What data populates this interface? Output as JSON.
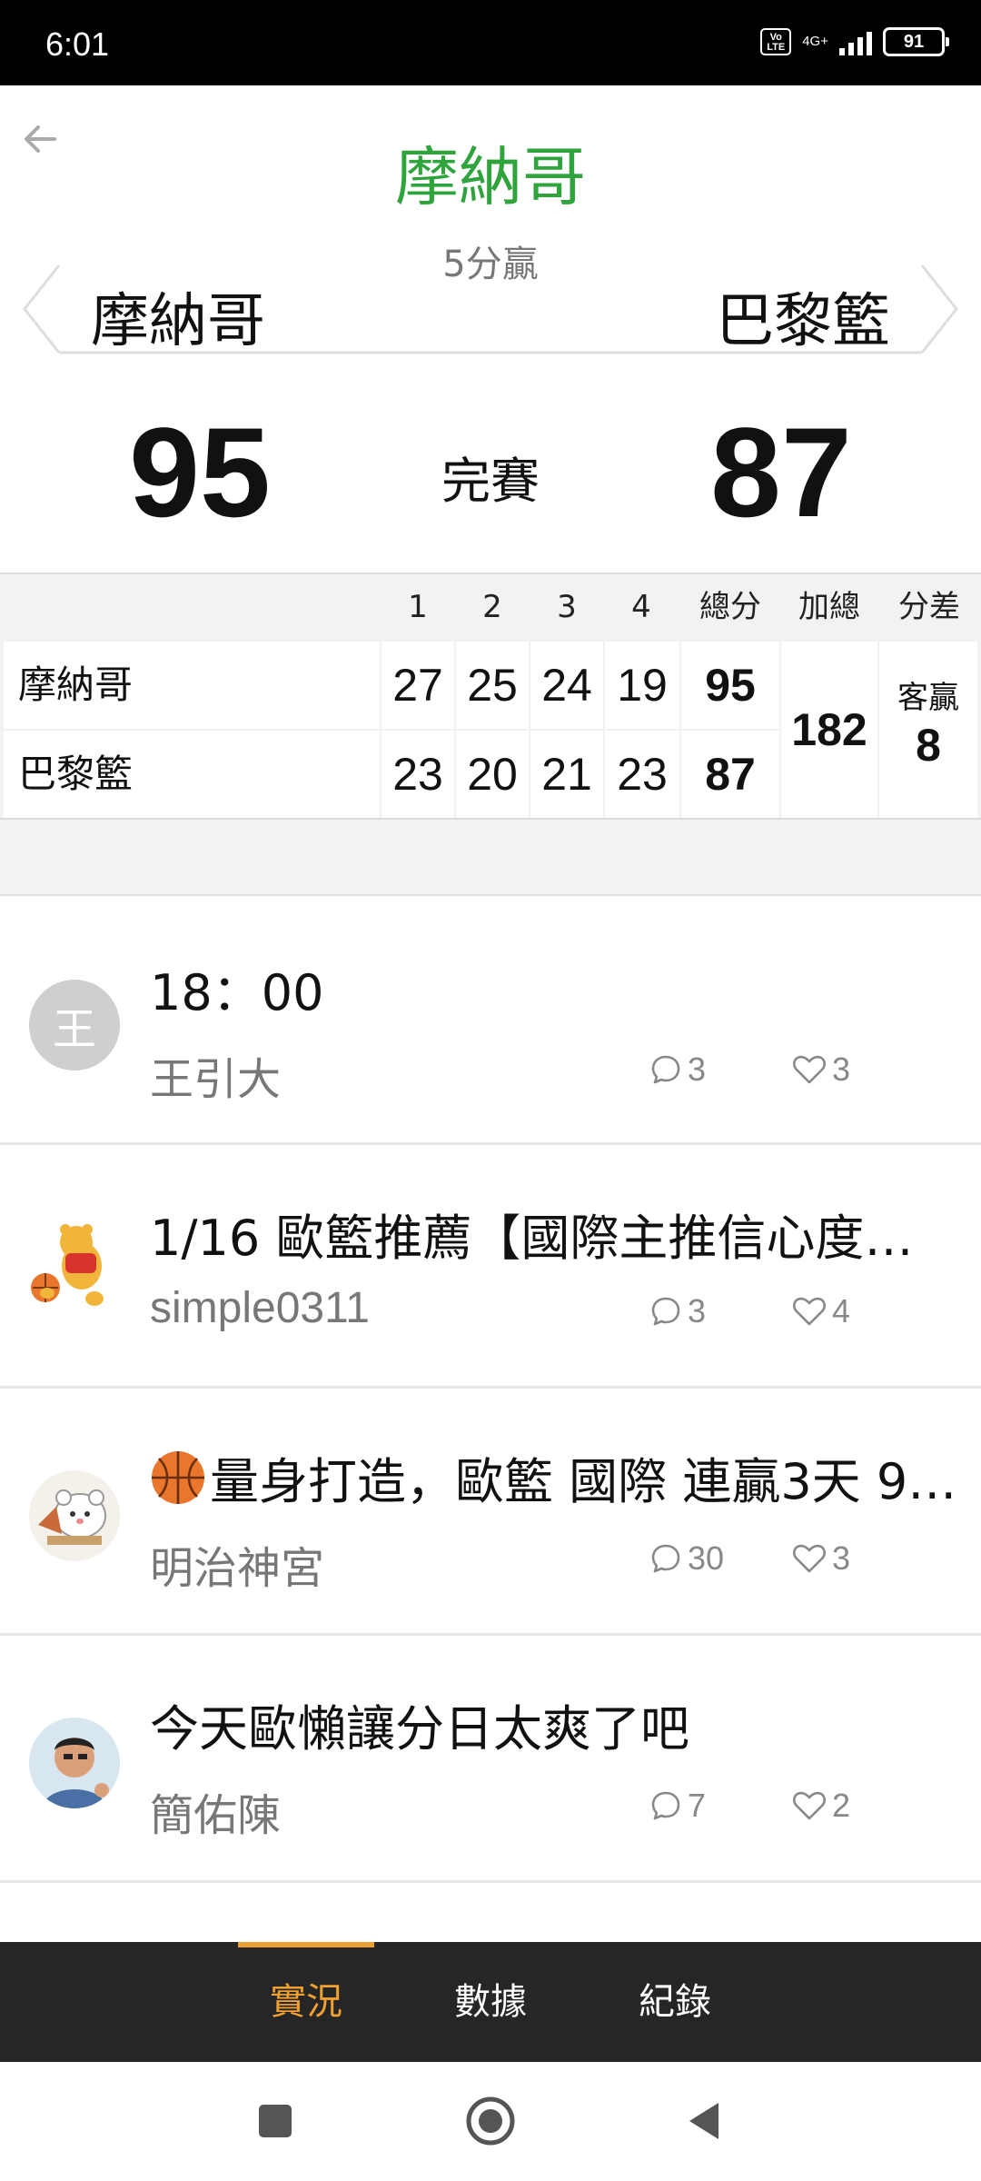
{
  "status_bar": {
    "time": "6:01",
    "volte": "Vo LTE",
    "network": "4G+",
    "battery": "91"
  },
  "header": {
    "title": "摩納哥",
    "subtitle": "5分贏",
    "home_team": "摩納哥",
    "away_team": "巴黎籃"
  },
  "score": {
    "home": "95",
    "away": "87",
    "status": "完賽"
  },
  "box_score": {
    "headers": [
      "1",
      "2",
      "3",
      "4",
      "總分",
      "加總",
      "分差"
    ],
    "rows": [
      {
        "team": "摩納哥",
        "q": [
          "27",
          "25",
          "24",
          "19"
        ],
        "total": "95"
      },
      {
        "team": "巴黎籃",
        "q": [
          "23",
          "20",
          "21",
          "23"
        ],
        "total": "87"
      }
    ],
    "combined": "182",
    "diff_label": "客贏",
    "diff_value": "8"
  },
  "posts": [
    {
      "title": "18：00",
      "author": "王引大",
      "comments": "3",
      "likes": "3",
      "avatar_text": "王"
    },
    {
      "title": "1/16 歐籃推薦【國際主推信心度高…",
      "author": "simple0311",
      "comments": "3",
      "likes": "4"
    },
    {
      "title": "量身打造，歐籃 國際 連贏3天 9…",
      "author": "明治神宮",
      "comments": "30",
      "likes": "3"
    },
    {
      "title": "今天歐懶讓分日太爽了吧",
      "author": "簡佑陳",
      "comments": "7",
      "likes": "2"
    }
  ],
  "tabs": [
    "實況",
    "數據",
    "紀錄"
  ],
  "colors": {
    "title_green": "#2fa33c",
    "tab_active": "#f0a030",
    "tab_bar_bg": "#262626"
  }
}
